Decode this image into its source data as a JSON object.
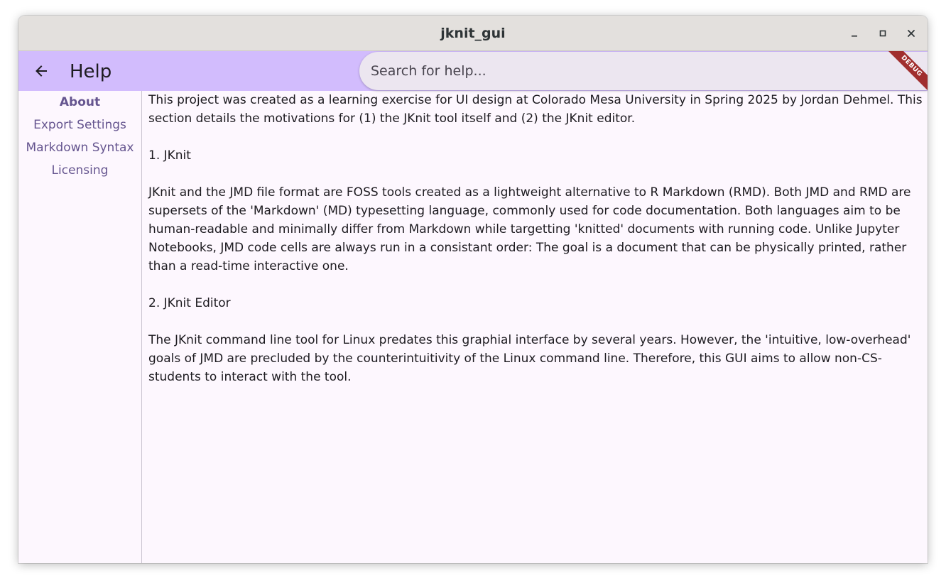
{
  "window": {
    "title": "jknit_gui",
    "controls": [
      "minimize",
      "maximize",
      "close"
    ]
  },
  "appbar": {
    "back_icon": "arrow-left-icon",
    "title": "Help",
    "search_placeholder": "Search for help...",
    "search_value": "",
    "debug_label": "DEBUG"
  },
  "sidebar": {
    "items": [
      {
        "label": "About",
        "active": true
      },
      {
        "label": "Export Settings",
        "active": false
      },
      {
        "label": "Markdown Syntax",
        "active": false
      },
      {
        "label": "Licensing",
        "active": false
      }
    ]
  },
  "content": {
    "paragraphs": [
      "This project was created as a learning exercise for UI design at Colorado Mesa University in Spring 2025 by Jordan Dehmel. This section details the motivations for (1) the JKnit tool itself and (2) the JKnit editor.",
      "1. JKnit",
      "JKnit and the JMD file format are FOSS tools created as a lightweight alternative to R Markdown (RMD). Both JMD and RMD are supersets of the 'Markdown' (MD) typesetting language, commonly used for code documentation. Both languages aim to be human-readable and minimally differ from Markdown while targetting 'knitted' documents with running code. Unlike Jupyter Notebooks, JMD code cells are always run in a consistant order: The goal is a document that can be physically printed, rather than a read-time interactive one.",
      "2. JKnit Editor",
      "The JKnit command line tool for Linux predates this graphial interface by several years. However, the 'intuitive, low-overhead' goals of JMD are precluded by the counterintuitivity of the Linux command line. Therefore, this GUI aims to allow non-CS-students to interact with the tool."
    ]
  },
  "colors": {
    "appbar": "#d2bcfd",
    "background": "#fdf7fe",
    "search": "#ece6f0",
    "nav_text": "#65558f",
    "debug_ribbon": "#a02e2e"
  }
}
